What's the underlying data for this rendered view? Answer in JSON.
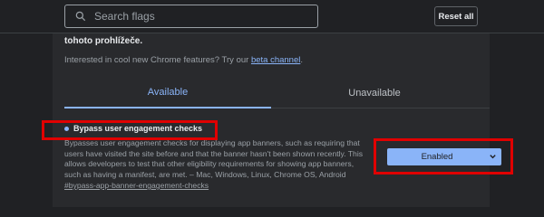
{
  "search": {
    "placeholder": "Search flags"
  },
  "toolbar": {
    "reset_label": "Reset all"
  },
  "intro": {
    "bold_text": "tohoto prohlížeče.",
    "prefix": "Interested in cool new Chrome features? Try our ",
    "link": "beta channel",
    "suffix": "."
  },
  "tabs": [
    {
      "label": "Available",
      "active": true
    },
    {
      "label": "Unavailable",
      "active": false
    }
  ],
  "flag": {
    "title": "Bypass user engagement checks",
    "description": "Bypasses user engagement checks for displaying app banners, such as requiring that users have visited the site before and that the banner hasn't been shown recently. This allows developers to test that other eligibility requirements for showing app banners, such as having a manifest, are met. – Mac, Windows, Linux, Chrome OS, Android",
    "anchor": "#bypass-app-banner-engagement-checks",
    "selected_value": "Enabled"
  },
  "colors": {
    "accent": "#8ab4f8",
    "highlight": "#e00000",
    "background": "#202124",
    "card": "#292a2d"
  }
}
